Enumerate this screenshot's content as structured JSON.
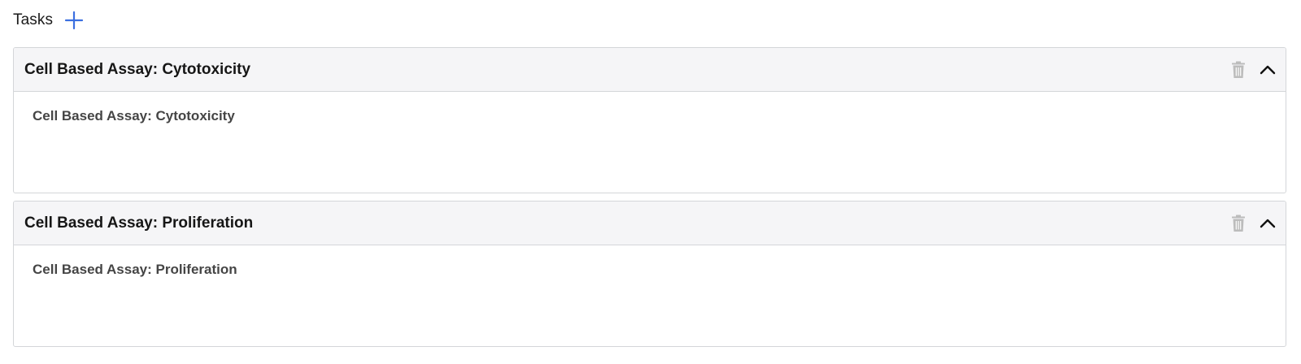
{
  "tasks": {
    "title": "Tasks",
    "add_icon": "plus-icon",
    "accent_color": "#3b6fe0"
  },
  "panels": [
    {
      "title": "Cell Based Assay: Cytotoxicity",
      "body_text": "Cell Based Assay: Cytotoxicity",
      "delete_icon": "trash-icon",
      "collapse_icon": "chevron-up-icon"
    },
    {
      "title": "Cell Based Assay: Proliferation",
      "body_text": "Cell Based Assay: Proliferation",
      "delete_icon": "trash-icon",
      "collapse_icon": "chevron-up-icon"
    }
  ]
}
